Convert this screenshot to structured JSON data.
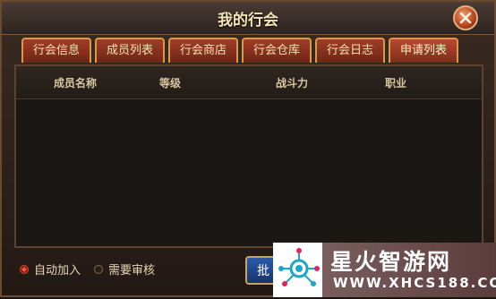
{
  "window": {
    "title": "我的行会"
  },
  "tabs": [
    {
      "label": "行会信息",
      "active": false
    },
    {
      "label": "成员列表",
      "active": false
    },
    {
      "label": "行会商店",
      "active": false
    },
    {
      "label": "行会仓库",
      "active": false
    },
    {
      "label": "行会日志",
      "active": false
    },
    {
      "label": "申请列表",
      "active": true
    }
  ],
  "table": {
    "columns": [
      "成员名称",
      "等级",
      "战斗力",
      "职业"
    ],
    "rows": []
  },
  "footer": {
    "options": [
      {
        "label": "自动加入",
        "selected": true
      },
      {
        "label": "需要审核",
        "selected": false
      }
    ],
    "button_label": "批"
  },
  "watermark": {
    "title": "星火智游网",
    "url": "WWW.XHCS188.COM"
  },
  "icons": {
    "close": "close-icon",
    "watermark_logo": "network-logo-icon"
  },
  "colors": {
    "tab": "#8a311f",
    "tab_border": "#d79a4b",
    "accent_red": "#ff4d3f",
    "button_blue": "#2a5ba8"
  }
}
